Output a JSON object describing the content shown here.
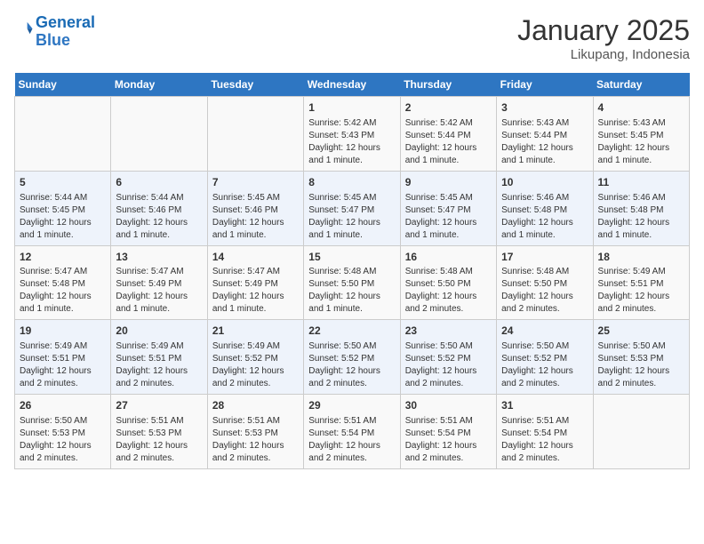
{
  "header": {
    "logo_line1": "General",
    "logo_line2": "Blue",
    "month": "January 2025",
    "location": "Likupang, Indonesia"
  },
  "days_of_week": [
    "Sunday",
    "Monday",
    "Tuesday",
    "Wednesday",
    "Thursday",
    "Friday",
    "Saturday"
  ],
  "weeks": [
    [
      {
        "day": "",
        "info": ""
      },
      {
        "day": "",
        "info": ""
      },
      {
        "day": "",
        "info": ""
      },
      {
        "day": "1",
        "info": "Sunrise: 5:42 AM\nSunset: 5:43 PM\nDaylight: 12 hours\nand 1 minute."
      },
      {
        "day": "2",
        "info": "Sunrise: 5:42 AM\nSunset: 5:44 PM\nDaylight: 12 hours\nand 1 minute."
      },
      {
        "day": "3",
        "info": "Sunrise: 5:43 AM\nSunset: 5:44 PM\nDaylight: 12 hours\nand 1 minute."
      },
      {
        "day": "4",
        "info": "Sunrise: 5:43 AM\nSunset: 5:45 PM\nDaylight: 12 hours\nand 1 minute."
      }
    ],
    [
      {
        "day": "5",
        "info": "Sunrise: 5:44 AM\nSunset: 5:45 PM\nDaylight: 12 hours\nand 1 minute."
      },
      {
        "day": "6",
        "info": "Sunrise: 5:44 AM\nSunset: 5:46 PM\nDaylight: 12 hours\nand 1 minute."
      },
      {
        "day": "7",
        "info": "Sunrise: 5:45 AM\nSunset: 5:46 PM\nDaylight: 12 hours\nand 1 minute."
      },
      {
        "day": "8",
        "info": "Sunrise: 5:45 AM\nSunset: 5:47 PM\nDaylight: 12 hours\nand 1 minute."
      },
      {
        "day": "9",
        "info": "Sunrise: 5:45 AM\nSunset: 5:47 PM\nDaylight: 12 hours\nand 1 minute."
      },
      {
        "day": "10",
        "info": "Sunrise: 5:46 AM\nSunset: 5:48 PM\nDaylight: 12 hours\nand 1 minute."
      },
      {
        "day": "11",
        "info": "Sunrise: 5:46 AM\nSunset: 5:48 PM\nDaylight: 12 hours\nand 1 minute."
      }
    ],
    [
      {
        "day": "12",
        "info": "Sunrise: 5:47 AM\nSunset: 5:48 PM\nDaylight: 12 hours\nand 1 minute."
      },
      {
        "day": "13",
        "info": "Sunrise: 5:47 AM\nSunset: 5:49 PM\nDaylight: 12 hours\nand 1 minute."
      },
      {
        "day": "14",
        "info": "Sunrise: 5:47 AM\nSunset: 5:49 PM\nDaylight: 12 hours\nand 1 minute."
      },
      {
        "day": "15",
        "info": "Sunrise: 5:48 AM\nSunset: 5:50 PM\nDaylight: 12 hours\nand 1 minute."
      },
      {
        "day": "16",
        "info": "Sunrise: 5:48 AM\nSunset: 5:50 PM\nDaylight: 12 hours\nand 2 minutes."
      },
      {
        "day": "17",
        "info": "Sunrise: 5:48 AM\nSunset: 5:50 PM\nDaylight: 12 hours\nand 2 minutes."
      },
      {
        "day": "18",
        "info": "Sunrise: 5:49 AM\nSunset: 5:51 PM\nDaylight: 12 hours\nand 2 minutes."
      }
    ],
    [
      {
        "day": "19",
        "info": "Sunrise: 5:49 AM\nSunset: 5:51 PM\nDaylight: 12 hours\nand 2 minutes."
      },
      {
        "day": "20",
        "info": "Sunrise: 5:49 AM\nSunset: 5:51 PM\nDaylight: 12 hours\nand 2 minutes."
      },
      {
        "day": "21",
        "info": "Sunrise: 5:49 AM\nSunset: 5:52 PM\nDaylight: 12 hours\nand 2 minutes."
      },
      {
        "day": "22",
        "info": "Sunrise: 5:50 AM\nSunset: 5:52 PM\nDaylight: 12 hours\nand 2 minutes."
      },
      {
        "day": "23",
        "info": "Sunrise: 5:50 AM\nSunset: 5:52 PM\nDaylight: 12 hours\nand 2 minutes."
      },
      {
        "day": "24",
        "info": "Sunrise: 5:50 AM\nSunset: 5:52 PM\nDaylight: 12 hours\nand 2 minutes."
      },
      {
        "day": "25",
        "info": "Sunrise: 5:50 AM\nSunset: 5:53 PM\nDaylight: 12 hours\nand 2 minutes."
      }
    ],
    [
      {
        "day": "26",
        "info": "Sunrise: 5:50 AM\nSunset: 5:53 PM\nDaylight: 12 hours\nand 2 minutes."
      },
      {
        "day": "27",
        "info": "Sunrise: 5:51 AM\nSunset: 5:53 PM\nDaylight: 12 hours\nand 2 minutes."
      },
      {
        "day": "28",
        "info": "Sunrise: 5:51 AM\nSunset: 5:53 PM\nDaylight: 12 hours\nand 2 minutes."
      },
      {
        "day": "29",
        "info": "Sunrise: 5:51 AM\nSunset: 5:54 PM\nDaylight: 12 hours\nand 2 minutes."
      },
      {
        "day": "30",
        "info": "Sunrise: 5:51 AM\nSunset: 5:54 PM\nDaylight: 12 hours\nand 2 minutes."
      },
      {
        "day": "31",
        "info": "Sunrise: 5:51 AM\nSunset: 5:54 PM\nDaylight: 12 hours\nand 2 minutes."
      },
      {
        "day": "",
        "info": ""
      }
    ]
  ]
}
